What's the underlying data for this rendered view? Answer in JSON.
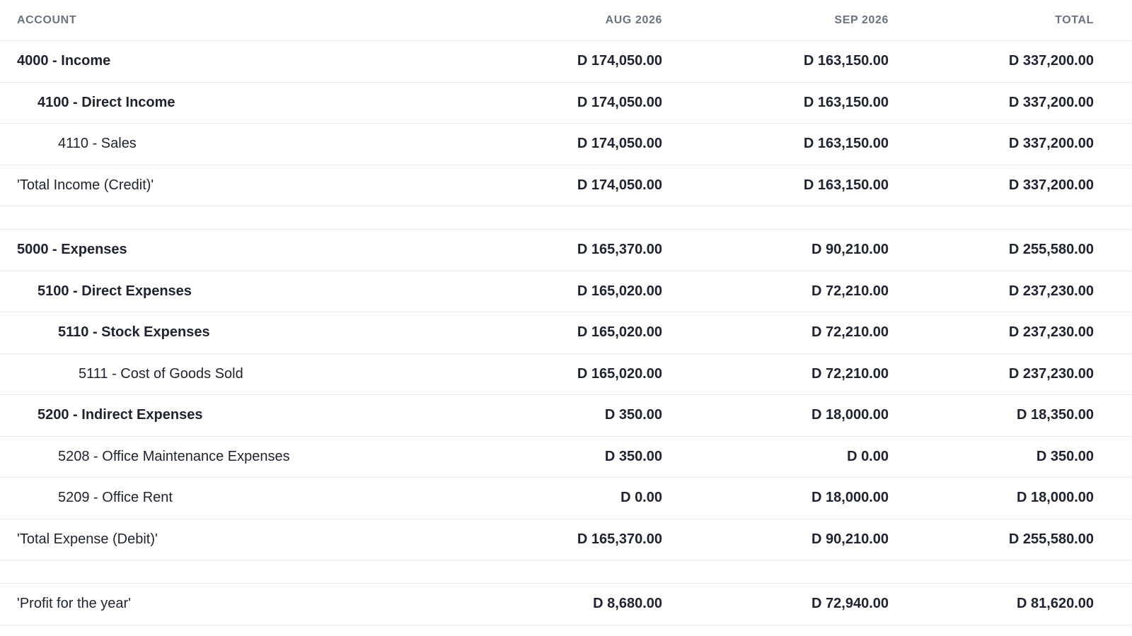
{
  "header": {
    "account": "ACCOUNT",
    "col1": "AUG 2026",
    "col2": "SEP 2026",
    "col3": "TOTAL"
  },
  "rows": [
    {
      "account": "4000 - Income",
      "aug": "D 174,050.00",
      "sep": "D 163,150.00",
      "total": "D 337,200.00"
    },
    {
      "account": "4100 - Direct Income",
      "aug": "D 174,050.00",
      "sep": "D 163,150.00",
      "total": "D 337,200.00"
    },
    {
      "account": "4110 - Sales",
      "aug": "D 174,050.00",
      "sep": "D 163,150.00",
      "total": "D 337,200.00"
    },
    {
      "account": "'Total Income (Credit)'",
      "aug": "D 174,050.00",
      "sep": "D 163,150.00",
      "total": "D 337,200.00"
    },
    {
      "account": "5000 - Expenses",
      "aug": "D 165,370.00",
      "sep": "D 90,210.00",
      "total": "D 255,580.00"
    },
    {
      "account": "5100 - Direct Expenses",
      "aug": "D 165,020.00",
      "sep": "D 72,210.00",
      "total": "D 237,230.00"
    },
    {
      "account": "5110 - Stock Expenses",
      "aug": "D 165,020.00",
      "sep": "D 72,210.00",
      "total": "D 237,230.00"
    },
    {
      "account": "5111 - Cost of Goods Sold",
      "aug": "D 165,020.00",
      "sep": "D 72,210.00",
      "total": "D 237,230.00"
    },
    {
      "account": "5200 - Indirect Expenses",
      "aug": "D 350.00",
      "sep": "D 18,000.00",
      "total": "D 18,350.00"
    },
    {
      "account": "5208 - Office Maintenance Expenses",
      "aug": "D 350.00",
      "sep": "D 0.00",
      "total": "D 350.00"
    },
    {
      "account": "5209 - Office Rent",
      "aug": "D 0.00",
      "sep": "D 18,000.00",
      "total": "D 18,000.00"
    },
    {
      "account": "'Total Expense (Debit)'",
      "aug": "D 165,370.00",
      "sep": "D 90,210.00",
      "total": "D 255,580.00"
    },
    {
      "account": "'Profit for the year'",
      "aug": "D 8,680.00",
      "sep": "D 72,940.00",
      "total": "D 81,620.00"
    }
  ]
}
